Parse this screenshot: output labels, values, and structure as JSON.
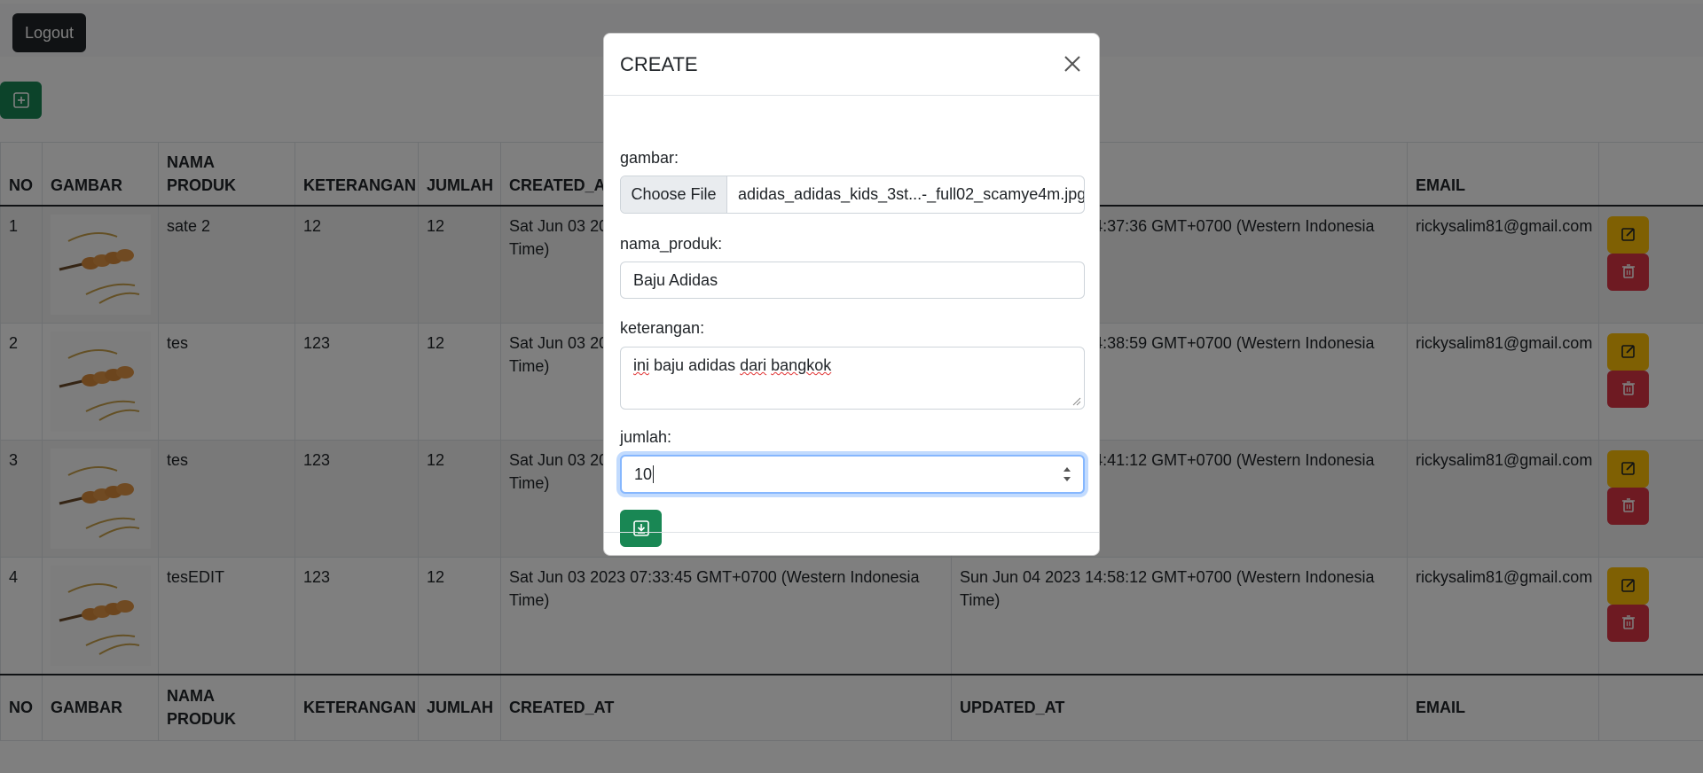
{
  "topbar": {
    "logout_label": "Logout"
  },
  "table": {
    "headers": [
      "NO",
      "GAMBAR",
      "NAMA PRODUK",
      "KETERANGAN",
      "JUMLAH",
      "CREATED_AT",
      "UPDATED_AT",
      "EMAIL",
      ""
    ],
    "rows": [
      {
        "no": "1",
        "nama_produk": "sate 2",
        "keterangan": "12",
        "jumlah": "12",
        "created_at": "Sat Jun 03 2023 07:33:45 GMT+0700 (Western Indonesia Time)",
        "updated_at": "Sun Jun 04 2023 14:37:36 GMT+0700 (Western Indonesia Time)",
        "email": "rickysalim81@gmail.com"
      },
      {
        "no": "2",
        "nama_produk": "tes",
        "keterangan": "123",
        "jumlah": "12",
        "created_at": "Sat Jun 03 2023 07:33:45 GMT+0700 (Western Indonesia Time)",
        "updated_at": "Sun Jun 04 2023 14:38:59 GMT+0700 (Western Indonesia Time)",
        "email": "rickysalim81@gmail.com"
      },
      {
        "no": "3",
        "nama_produk": "tes",
        "keterangan": "123",
        "jumlah": "12",
        "created_at": "Sat Jun 03 2023 07:33:45 GMT+0700 (Western Indonesia Time)",
        "updated_at": "Sun Jun 04 2023 14:41:12 GMT+0700 (Western Indonesia Time)",
        "email": "rickysalim81@gmail.com"
      },
      {
        "no": "4",
        "nama_produk": "tesEDIT",
        "keterangan": "123",
        "jumlah": "12",
        "created_at": "Sat Jun 03 2023 07:33:45 GMT+0700 (Western Indonesia Time)",
        "updated_at": "Sun Jun 04 2023 14:58:12 GMT+0700 (Western Indonesia Time)",
        "email": "rickysalim81@gmail.com"
      }
    ],
    "image_icon": "satay-image"
  },
  "modal": {
    "title": "CREATE",
    "gambar_label": "gambar:",
    "file_button_label": "Choose File",
    "file_name": "adidas_adidas_kids_3st...-_full02_scamye4m.jpg",
    "nama_produk_label": "nama_produk:",
    "nama_produk_value": "Baju Adidas",
    "keterangan_label": "keterangan:",
    "keterangan_words": [
      "ini",
      "baju adidas",
      "dari",
      "bangkok"
    ],
    "jumlah_label": "jumlah:",
    "jumlah_value": "10"
  },
  "colors": {
    "success": "#198754",
    "warning": "#ffc107",
    "danger": "#dc3545",
    "dark": "#212529",
    "focus": "#86b7fe"
  }
}
